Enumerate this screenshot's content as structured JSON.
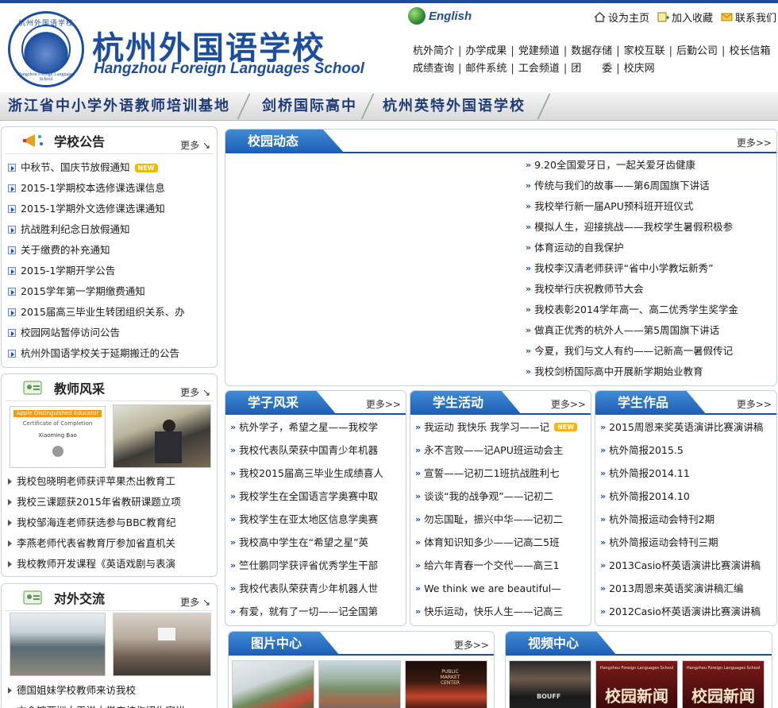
{
  "header": {
    "seal_top": "杭州外国语学校",
    "seal_bottom": "Hangzhou Foreign Languages School",
    "school_name_cn": "杭州外国语学校",
    "school_name_en": "Hangzhou Foreign Languages School",
    "english_link": "English",
    "util": {
      "home": "设为主页",
      "favorite": "加入收藏",
      "contact": "联系我们"
    },
    "nav_row1": [
      "杭外简介",
      "办学成果",
      "党建频道",
      "数据存储",
      "家校互联",
      "后勤公司",
      "校长信箱"
    ],
    "nav_row2": [
      "成绩查询",
      "邮件系统",
      "工会频道",
      "团　　委",
      "校庆网"
    ]
  },
  "banner": [
    "浙江省中小学外语教师培训基地",
    "剑桥国际高中",
    "杭州英特外国语学校"
  ],
  "announcements": {
    "title": "学校公告",
    "more": "更多",
    "items": [
      "中秋节、国庆节放假通知",
      "2015-1学期校本选修课选课信息",
      "2015-1学期外文选修课选课通知",
      "抗战胜利纪念日放假通知",
      "关于缴费的补充通知",
      "2015-1学期开学公告",
      "2015学年第一学期缴费通知",
      "2015届高三毕业生转团组织关系、办",
      "校园网站暂停访问公告",
      "杭州外国语学校关于延期搬迁的公告"
    ],
    "new_badge": "NEW"
  },
  "teachers": {
    "title": "教师风采",
    "more": "更多",
    "cert_title": "Apple Distinguished Educator",
    "cert_sub": "Certificate of Completion",
    "cert_name": "Xiaoming Bao",
    "items": [
      "我校包晓明老师获评苹果杰出教育工",
      "我校三课题获2015年省教研课题立项",
      "我校邹海连老师获选参与BBC教育纪",
      "李燕老师代表省教育厅参加省直机关",
      "我校教师开发课程《英语戏剧与表演"
    ]
  },
  "exchange": {
    "title": "对外交流",
    "more": "更多",
    "items": [
      "德国姐妹学校教师来访我校",
      "立命馆亚洲太平洋大学来校作招生宣讲"
    ]
  },
  "campus_news": {
    "title": "校园动态",
    "more": "更多>>",
    "items": [
      "9.20全国爱牙日，一起关爱牙齿健康",
      "传统与我们的故事——第6周国旗下讲话",
      "我校举行新一届APU预科班开班仪式",
      "模拟人生，迎接挑战——我校学生暑假积极参",
      "体育运动的自我保护",
      "我校李汉清老师获评“省中小学教坛新秀”",
      "我校举行庆祝教师节大会",
      "我校表彰2014学年高一、高二优秀学生奖学金",
      "做真正优秀的杭外人——第5周国旗下讲话",
      "今夏，我们与文人有约——记新高一暑假传记",
      "我校剑桥国际高中开展新学期始业教育"
    ]
  },
  "scholars": {
    "title": "学子风采",
    "more": "更多>>",
    "items": [
      "杭外学子，希望之星——我校学",
      "我校代表队荣获中国青少年机器",
      "我校2015届高三毕业生成绩喜人",
      "我校学生在全国语言学奥赛中取",
      "我校学生在亚太地区信息学奥赛",
      "我校高中学生在“希望之星”英",
      "竺仕鹏同学获评省优秀学生干部",
      "我校代表队荣获青少年机器人世",
      "有爱，就有了一切——记全国第"
    ]
  },
  "activities": {
    "title": "学生活动",
    "more": "更多>>",
    "new_badge": "NEW",
    "items": [
      "我运动 我快乐 我学习——记",
      "永不言败——记APU班运动会主",
      "宣誓——记初二1班抗战胜利七",
      "谈谈“我的战争观”——记初二",
      "勿忘国耻，振兴中华——记初二",
      "体育知识知多少——记高二5班",
      "给六年青春一个交代——高三1",
      "We think we are beautiful—",
      "快乐运动，快乐人生——记高三"
    ]
  },
  "works": {
    "title": "学生作品",
    "more": "更多>>",
    "items": [
      "2015周恩来奖英语演讲比赛演讲稿",
      "杭外简报2015.5",
      "杭外简报2014.11",
      "杭外简报2014.10",
      "杭外简报运动会特刊2期",
      "杭外简报运动会特刊三期",
      "2013Casio杯英语演讲比赛演讲稿",
      "2013周恩来英语奖演讲稿汇编",
      "2012Casio杯英语演讲比赛演讲稿"
    ]
  },
  "pictures": {
    "title": "图片中心",
    "more": "更多>>",
    "neon": "PUBLIC MARKET CENTER"
  },
  "videos": {
    "title": "视频中心",
    "thumb_text": "校园新闻",
    "thumb_sub": "Hangzhou Foreign Languages School",
    "shirt": "BOUFF"
  },
  "colors": {
    "brand": "#1d4e9e",
    "tab_top": "#3f8bd6",
    "tab_bottom": "#1d5db3",
    "new_badge": "#f5b800"
  }
}
